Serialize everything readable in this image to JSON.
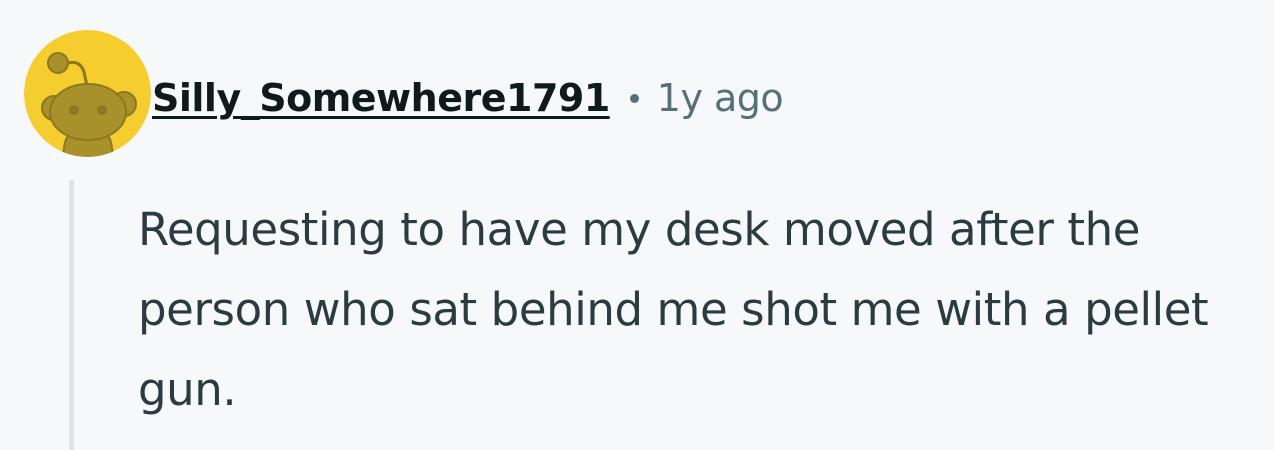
{
  "comment": {
    "author": "Silly_Somewhere1791",
    "separator": "•",
    "timestamp": "1y ago",
    "body": "Requesting to have my desk moved after the person who sat behind me shot me with a pellet gun.",
    "avatar_icon": "snoo-avatar-icon"
  },
  "colors": {
    "background": "#f7f8fa",
    "avatar_bg": "#f6cd2f",
    "avatar_figure": "#a8902a",
    "username": "#0f1a1c",
    "meta_text": "#576f76",
    "body_text": "#2a3c42",
    "thread_line": "#dfe3e6"
  }
}
